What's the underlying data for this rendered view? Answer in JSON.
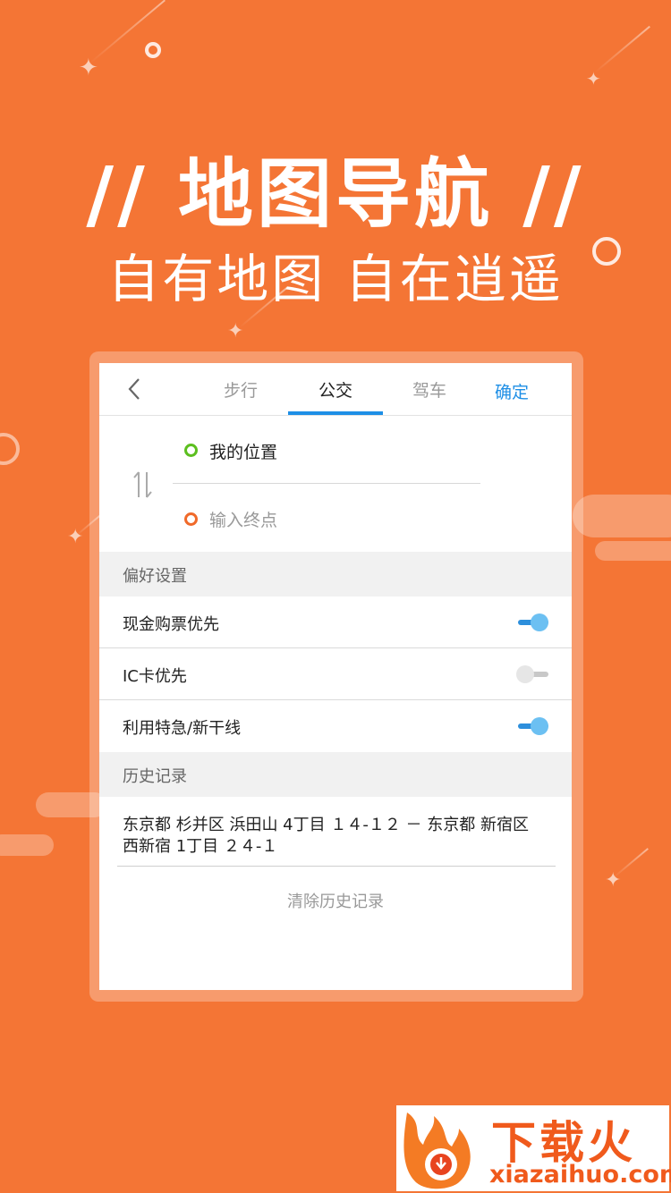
{
  "promo": {
    "headline": "// 地图导航 //",
    "subline": "自有地图 自在逍遥"
  },
  "navbar": {
    "tabs": [
      {
        "label": "步行",
        "active": false
      },
      {
        "label": "公交",
        "active": true
      },
      {
        "label": "驾车",
        "active": false
      }
    ],
    "confirm_label": "确定"
  },
  "route": {
    "start": "我的位置",
    "end_placeholder": "输入终点"
  },
  "preferences": {
    "header": "偏好设置",
    "items": [
      {
        "label": "现金购票优先",
        "enabled": true
      },
      {
        "label": "IC卡优先",
        "enabled": false
      },
      {
        "label": "利用特急/新干线",
        "enabled": true
      }
    ]
  },
  "history": {
    "header": "历史记录",
    "entry_line1": "东京都 杉并区 浜田山 4丁目 １４-１２ － 东京都 新宿区",
    "entry_line2": "西新宿 1丁目 ２４-１",
    "clear_label": "清除历史记录"
  },
  "watermark": {
    "title": "下载火",
    "url": "xiazaihuo.com"
  },
  "colors": {
    "background": "#f47535",
    "accent": "#1e8fe6",
    "start_dot": "#5cbf1f",
    "end_dot": "#f06a2a"
  }
}
